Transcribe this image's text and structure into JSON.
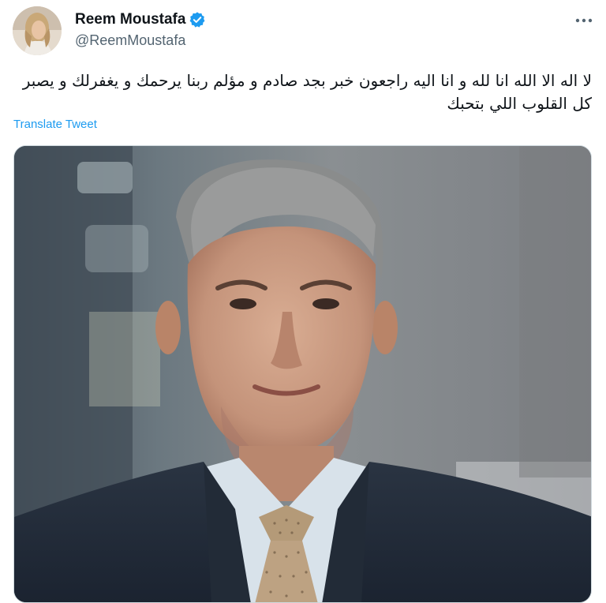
{
  "author": {
    "display_name": "Reem Moustafa",
    "handle": "@ReemMoustafa",
    "verified": true,
    "avatar_icon": "profile-photo"
  },
  "tweet": {
    "text": "لا اله الا الله انا لله و انا اليه راجعون خبر بجد صادم و مؤلم ربنا يرحمك و يغفرلك و يصبر كل القلوب اللي بتحبك",
    "translate_label": "Translate Tweet",
    "media_description_icon": "photo-of-man-in-suit"
  },
  "actions": {
    "more_icon": "more-options-icon"
  },
  "colors": {
    "link": "#1d9bf0",
    "verified": "#1d9bf0",
    "text_primary": "#0f1419",
    "text_secondary": "#536471"
  }
}
